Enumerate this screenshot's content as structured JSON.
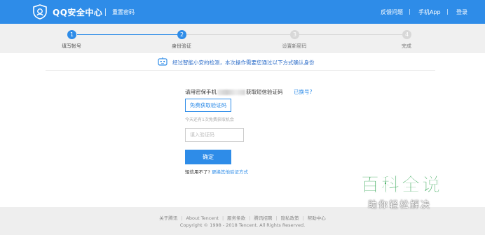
{
  "header": {
    "brand": "QQ安全中心",
    "subtitle": "重置密码",
    "links": [
      "反馈问题",
      "手机App",
      "登录"
    ]
  },
  "steps": [
    {
      "number": "1",
      "label": "填写帐号",
      "state": "done"
    },
    {
      "number": "2",
      "label": "身份验证",
      "state": "active"
    },
    {
      "number": "3",
      "label": "设置新密码",
      "state": "pending"
    },
    {
      "number": "4",
      "label": "完成",
      "state": "pending"
    }
  ],
  "notice": {
    "text": "经过智能小安的检测，本次操作需要您通过以下方式确认身份",
    "icon": "robot-icon"
  },
  "verify": {
    "phone_prefix": "请用密保手机",
    "phone_suffix": "获取短信验证码",
    "lost_link": "已换号?",
    "get_code_button": "免费获取验证码",
    "hint": "今天还有1次免费获取机会",
    "input_placeholder": "填入验证码",
    "confirm_button": "确定",
    "alt_prefix": "短信用不了?",
    "alt_link": "更换其他验证方式"
  },
  "footer": {
    "links": [
      "关于腾讯",
      "About Tencent",
      "服务条款",
      "腾讯招聘",
      "隐私政策",
      "帮助中心"
    ],
    "copyright": "Copyright © 1998 - 2018 Tencent. All Rights Reserved."
  },
  "watermark": {
    "title": "百科全说",
    "subtitle": "助你轻松解决"
  },
  "colors": {
    "primary": "#2e8ce8",
    "inactive": "#d8d8d8",
    "watermark_green": "#1a9a3e"
  }
}
